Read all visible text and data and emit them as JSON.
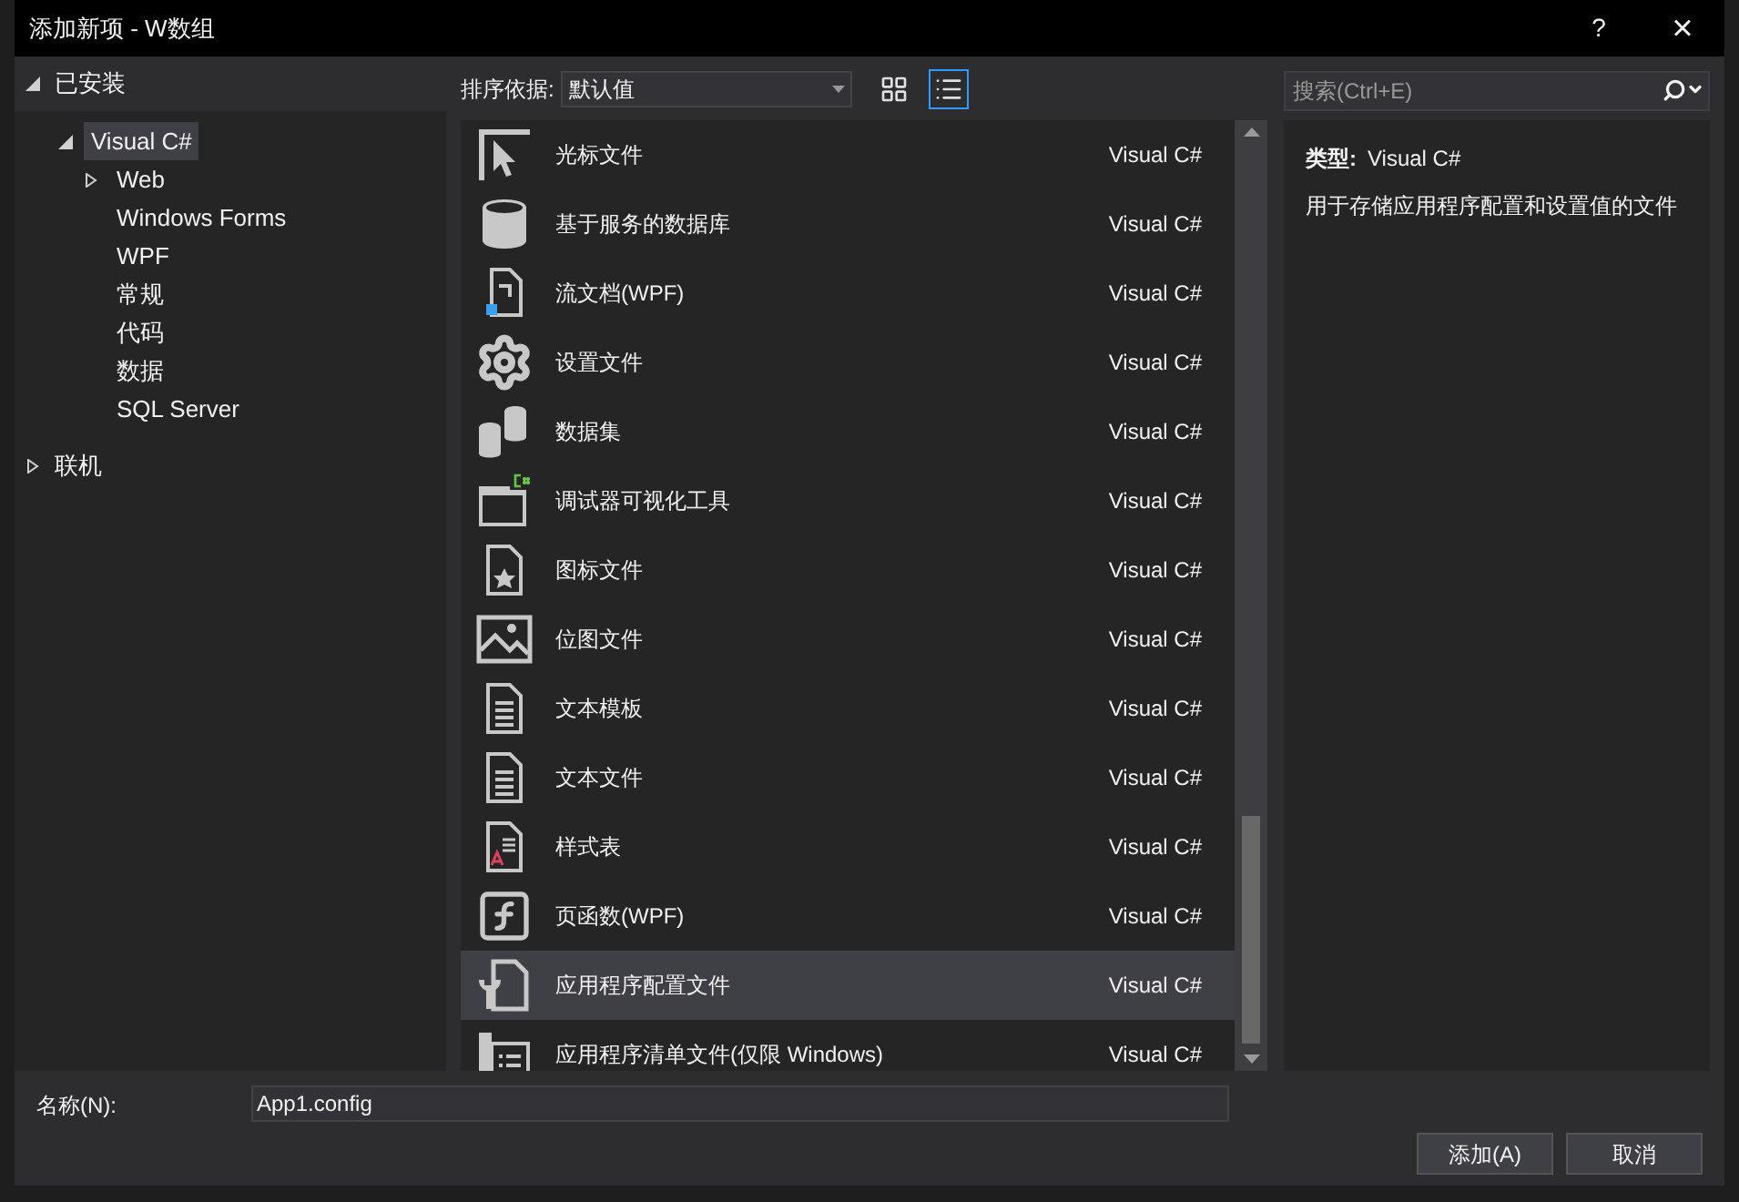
{
  "window": {
    "title": "添加新项 - W数组",
    "help": "?",
    "close": "×"
  },
  "tree": [
    {
      "label": "已安装",
      "expanded": true,
      "selected": false,
      "children": [
        {
          "label": "Visual C#",
          "expanded": true,
          "selected": true,
          "children": [
            {
              "label": "Web",
              "expanded": false,
              "selected": false
            },
            {
              "label": "Windows Forms",
              "selected": false
            },
            {
              "label": "WPF",
              "selected": false
            },
            {
              "label": "常规",
              "selected": false
            },
            {
              "label": "代码",
              "selected": false
            },
            {
              "label": "数据",
              "selected": false
            },
            {
              "label": "SQL Server",
              "selected": false
            }
          ]
        }
      ]
    },
    {
      "label": "联机",
      "expanded": false,
      "selected": false
    }
  ],
  "toolbar": {
    "sort_label": "排序依据:",
    "sort_value": "默认值",
    "views": [
      {
        "kind": "grid",
        "selected": false
      },
      {
        "kind": "list",
        "selected": true
      }
    ]
  },
  "search": {
    "placeholder": "搜索(Ctrl+E)"
  },
  "items": [
    {
      "kind": "cursor",
      "name": "光标文件",
      "type": "Visual C#",
      "selected": false
    },
    {
      "kind": "database",
      "name": "基于服务的数据库",
      "type": "Visual C#",
      "selected": false
    },
    {
      "kind": "flowdoc",
      "name": "流文档(WPF)",
      "type": "Visual C#",
      "selected": false
    },
    {
      "kind": "settings",
      "name": "设置文件",
      "type": "Visual C#",
      "selected": false
    },
    {
      "kind": "dataset",
      "name": "数据集",
      "type": "Visual C#",
      "selected": false
    },
    {
      "kind": "visualizer",
      "name": "调试器可视化工具",
      "type": "Visual C#",
      "selected": false
    },
    {
      "kind": "iconfile",
      "name": "图标文件",
      "type": "Visual C#",
      "selected": false
    },
    {
      "kind": "bitmap",
      "name": "位图文件",
      "type": "Visual C#",
      "selected": false
    },
    {
      "kind": "text",
      "name": "文本模板",
      "type": "Visual C#",
      "selected": false
    },
    {
      "kind": "text",
      "name": "文本文件",
      "type": "Visual C#",
      "selected": false
    },
    {
      "kind": "stylesheet",
      "name": "样式表",
      "type": "Visual C#",
      "selected": false
    },
    {
      "kind": "function",
      "name": "页函数(WPF)",
      "type": "Visual C#",
      "selected": false
    },
    {
      "kind": "config",
      "name": "应用程序配置文件",
      "type": "Visual C#",
      "selected": true
    },
    {
      "kind": "manifest",
      "name": "应用程序清单文件(仅限 Windows)",
      "type": "Visual C#",
      "selected": false
    }
  ],
  "details": {
    "type_label": "类型:",
    "type_value": "Visual C#",
    "description": "用于存储应用程序配置和设置值的文件"
  },
  "name_field": {
    "label": "名称(N):",
    "value": "App1.config"
  },
  "buttons": [
    "添加(A)",
    "取消"
  ]
}
